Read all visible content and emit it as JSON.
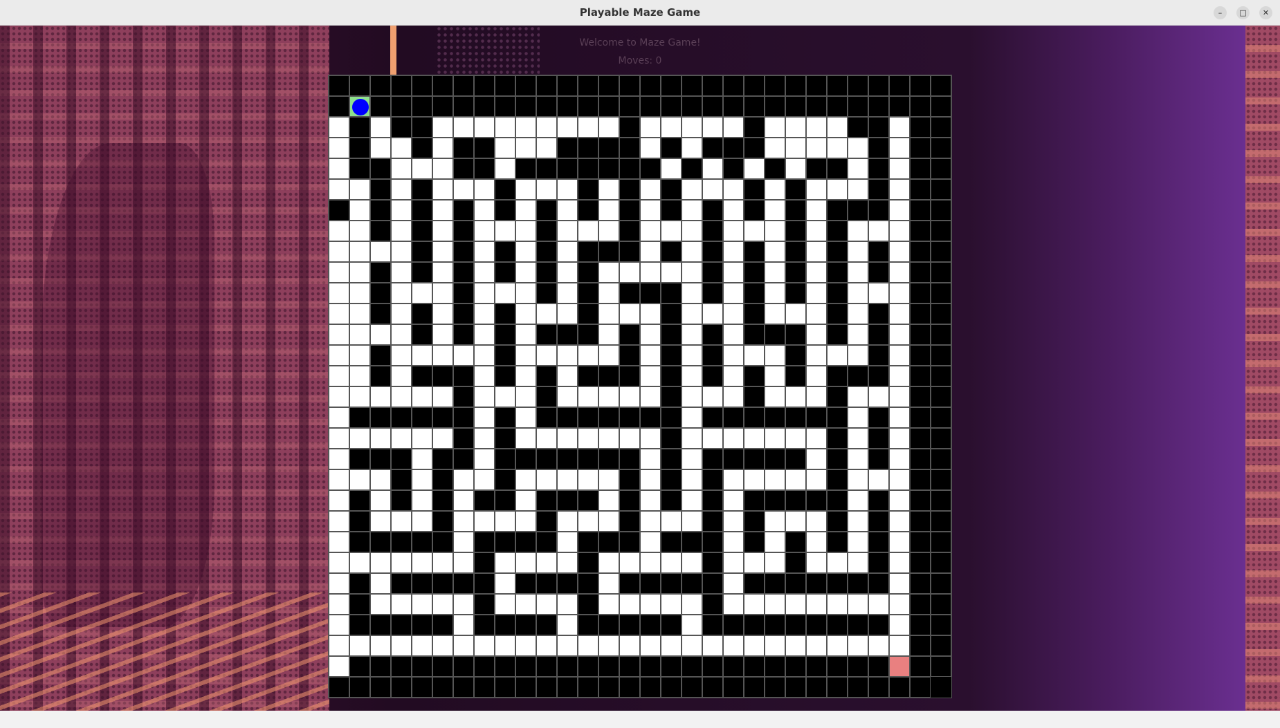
{
  "window": {
    "title": "Playable Maze Game"
  },
  "controls": {
    "minimize_icon": "minimize-icon",
    "maximize_icon": "maximize-icon",
    "close_icon": "close-icon"
  },
  "status": {
    "welcome": "Welcome to Maze Game!",
    "moves": "Moves: 0"
  },
  "colors": {
    "wall": "#000000",
    "path": "#ffffff",
    "start": "#8ee08e",
    "goal": "#e98080",
    "player": "#0000ff"
  },
  "maze": {
    "rows": 30,
    "cols": 30,
    "start": [
      1,
      1
    ],
    "goal": [
      28,
      28
    ],
    "player": [
      1,
      1
    ],
    "grid": [
      "##############################",
      "#S###########################",
      "#.#.##.........#.....#....##.#",
      "#.#..#.##...####.#.###.....#.#",
      "#.##...##.#######.#.#.#.##.#.#",
      "#..#.#...#...#.#.#...#.#...#.#",
      "##.#.#.#.#.#.#.#.#.#.#.#.###.#",
      "#..#.#.#...#...#...#...#.#...#",
      "#....#.#.#.#.###.#.#.#.#.#.#.#",
      "#..#.#.#.#.#.#.....#.#.#.#.#.#",
      "#..#...#...#.#.###.#.#.#.#...#",
      "#..#.#.#.#...#...#...#...#.#.#",
      "#....#.#.#.###.#.#.#.###.#.#.#",
      "#..#.....#.....#.#.#...#...#.#",
      "#..#.###.#.#.###.#.#.#.#.###.#",
      "#......#...#.....#...#...#...#",
      "#.######.#.#######.#######.#.#",
      "#......#.#.......#.......#.#.#",
      "#.###.##.#######.#.#####.#.#.#",
      "#...#.#..#.....#.#.#.....#...#",
      "#.#.#.#.##.###.#.#.#.#####.#.#",
      "#.#...#....#...#...#.#...#.#.#",
      "#.#####.####.###.###.#.#.#.#.#",
      "#.......#....#.....#...#...#.#",
      "#.#.#####.####.#####.#######.#",
      "#.#.....#....#.....#.........#",
      "#.#####.####.#####.#########.#",
      "#............................#",
      "#.##########################G#",
      "##############################"
    ]
  }
}
